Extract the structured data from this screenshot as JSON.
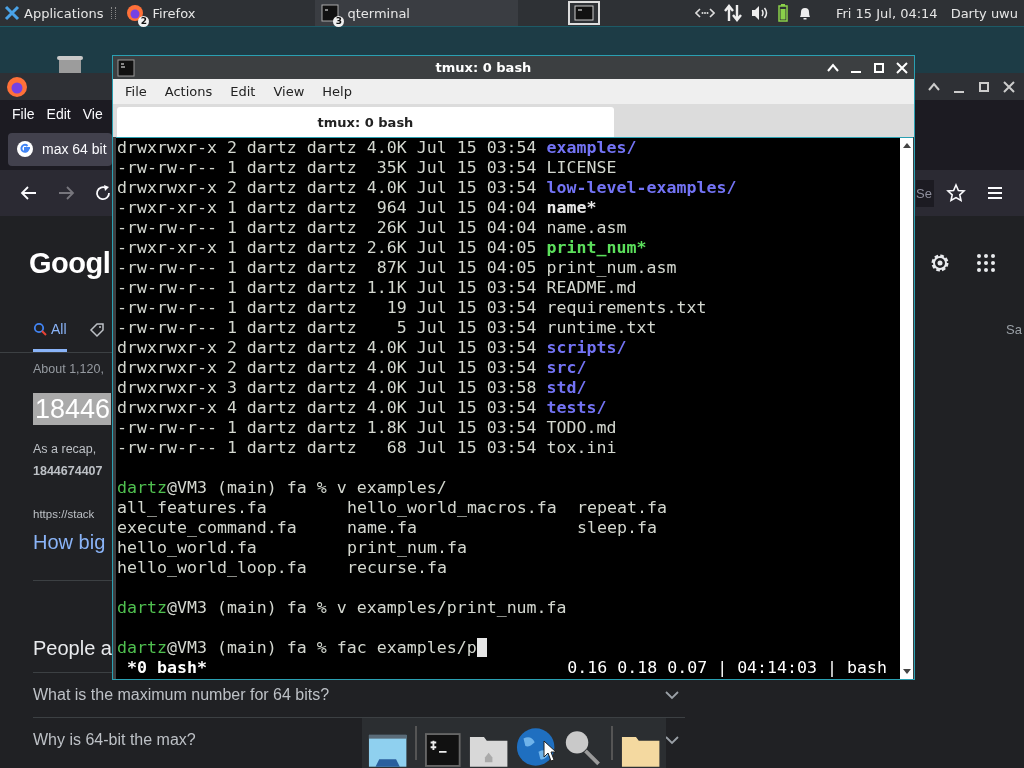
{
  "top_panel": {
    "menu_label": "Applications",
    "taskbar": [
      {
        "label": "Firefox",
        "badge": "2",
        "selected": false
      },
      {
        "label": "qterminal",
        "badge": "3",
        "selected": true
      }
    ],
    "clock": "Fri 15 Jul, 04:14",
    "user": "Darty uwu"
  },
  "browser": {
    "menu": [
      "File",
      "Edit",
      "Vie"
    ],
    "tab": "max 64 bit",
    "search_text": "Se",
    "logo": "Googl",
    "search_tabs": [
      {
        "label": "All",
        "selected": true
      }
    ],
    "right_tab": "Sa",
    "result_count": "About 1,120,",
    "answer": "18446",
    "snippet": "As a recap, ",
    "snippet_bold": "1844674407",
    "url": "https://stack",
    "link": "How big",
    "section": "People a",
    "questions": [
      "What is the maximum number for 64 bits?",
      "Why is 64-bit the max?"
    ]
  },
  "terminal": {
    "title": "tmux: 0 bash",
    "menu": [
      "File",
      "Actions",
      "Edit",
      "View",
      "Help"
    ],
    "tabs": [
      {
        "label": "tmux: 0 bash",
        "selected": true
      }
    ],
    "lines": [
      {
        "kind": "dir",
        "info": "drwxrwxr-x 2 dartz dartz 4.0K Jul 15 03:54",
        "name": "examples/",
        "color": "#7373f5"
      },
      {
        "kind": "file",
        "info": "-rw-rw-r-- 1 dartz dartz  35K Jul 15 03:54",
        "name": "LICENSE",
        "color": "#d3d7cf"
      },
      {
        "kind": "dir",
        "info": "drwxrwxr-x 2 dartz dartz 4.0K Jul 15 03:54",
        "name": "low-level-examples/",
        "color": "#7373f5"
      },
      {
        "kind": "exec",
        "info": "-rwxr-xr-x 1 dartz dartz  964 Jul 15 04:04",
        "name": "name*",
        "color": "#e8e8e8"
      },
      {
        "kind": "file",
        "info": "-rw-rw-r-- 1 dartz dartz  26K Jul 15 04:04",
        "name": "name.asm",
        "color": "#d3d7cf"
      },
      {
        "kind": "exec",
        "info": "-rwxr-xr-x 1 dartz dartz 2.6K Jul 15 04:05",
        "name": "print_num*",
        "color": "#5ce05c"
      },
      {
        "kind": "file",
        "info": "-rw-rw-r-- 1 dartz dartz  87K Jul 15 04:05",
        "name": "print_num.asm",
        "color": "#d3d7cf"
      },
      {
        "kind": "file",
        "info": "-rw-rw-r-- 1 dartz dartz 1.1K Jul 15 03:54",
        "name": "README.md",
        "color": "#d3d7cf"
      },
      {
        "kind": "file",
        "info": "-rw-rw-r-- 1 dartz dartz   19 Jul 15 03:54",
        "name": "requirements.txt",
        "color": "#d3d7cf"
      },
      {
        "kind": "file",
        "info": "-rw-rw-r-- 1 dartz dartz    5 Jul 15 03:54",
        "name": "runtime.txt",
        "color": "#d3d7cf"
      },
      {
        "kind": "dir",
        "info": "drwxrwxr-x 2 dartz dartz 4.0K Jul 15 03:54",
        "name": "scripts/",
        "color": "#7373f5"
      },
      {
        "kind": "dir",
        "info": "drwxrwxr-x 2 dartz dartz 4.0K Jul 15 03:54",
        "name": "src/",
        "color": "#7373f5"
      },
      {
        "kind": "dir",
        "info": "drwxrwxr-x 3 dartz dartz 4.0K Jul 15 03:58",
        "name": "std/",
        "color": "#7373f5"
      },
      {
        "kind": "dir",
        "info": "drwxrwxr-x 4 dartz dartz 4.0K Jul 15 03:54",
        "name": "tests/",
        "color": "#7373f5"
      },
      {
        "kind": "file",
        "info": "-rw-rw-r-- 1 dartz dartz 1.8K Jul 15 03:54",
        "name": "TODO.md",
        "color": "#d3d7cf"
      },
      {
        "kind": "file",
        "info": "-rw-rw-r-- 1 dartz dartz   68 Jul 15 03:54",
        "name": "tox.ini",
        "color": "#d3d7cf"
      },
      {
        "kind": "blank"
      },
      {
        "kind": "prompt",
        "user": "dartz",
        "host": "@VM3 (main) fa %",
        "command": "v examples/",
        "cursor": false
      },
      {
        "kind": "columns",
        "cells": [
          "all_features.fa",
          "hello_world_macros.fa",
          "repeat.fa"
        ]
      },
      {
        "kind": "columns",
        "cells": [
          "execute_command.fa",
          "name.fa",
          "sleep.fa"
        ]
      },
      {
        "kind": "columns",
        "cells": [
          "hello_world.fa",
          "print_num.fa"
        ]
      },
      {
        "kind": "columns",
        "cells": [
          "hello_world_loop.fa",
          "recurse.fa"
        ]
      },
      {
        "kind": "blank"
      },
      {
        "kind": "prompt",
        "user": "dartz",
        "host": "@VM3 (main) fa %",
        "command": "v examples/print_num.fa",
        "cursor": false
      },
      {
        "kind": "blank"
      },
      {
        "kind": "prompt",
        "user": "dartz",
        "host": "@VM3 (main) fa %",
        "command": "fac examples/p",
        "cursor": true
      }
    ],
    "status": {
      "window": "*0 bash*",
      "info": "0.16 0.18 0.07 | 04:14:03 | bash"
    }
  }
}
